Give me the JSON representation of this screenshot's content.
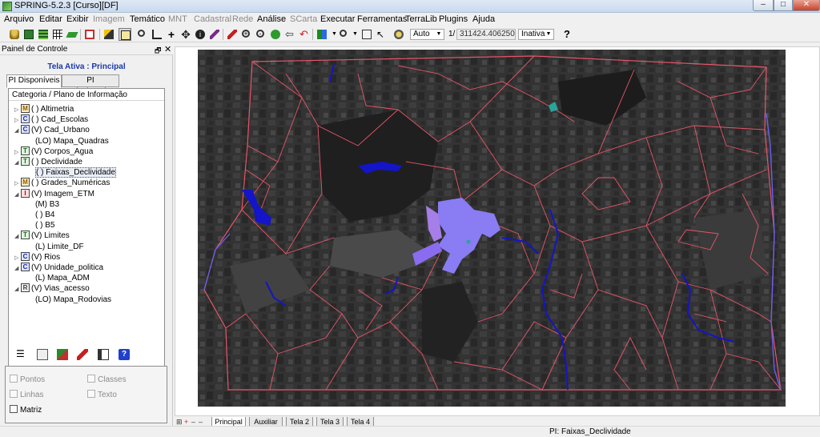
{
  "window": {
    "title": "SPRING-5.2.3 [Curso][DF]",
    "min": "–",
    "max": "□",
    "close": "✕"
  },
  "menu": [
    {
      "label": "Arquivo",
      "enabled": true
    },
    {
      "label": "Editar",
      "enabled": true
    },
    {
      "label": "Exibir",
      "enabled": true
    },
    {
      "label": "Imagem",
      "enabled": false
    },
    {
      "label": "Temático",
      "enabled": true
    },
    {
      "label": "MNT",
      "enabled": false
    },
    {
      "label": "Cadastral",
      "enabled": false
    },
    {
      "label": "Rede",
      "enabled": false
    },
    {
      "label": "Análise",
      "enabled": true
    },
    {
      "label": "SCarta",
      "enabled": false
    },
    {
      "label": "Executar",
      "enabled": true
    },
    {
      "label": "Ferramentas",
      "enabled": true
    },
    {
      "label": "TerraLib",
      "enabled": true
    },
    {
      "label": "Plugins",
      "enabled": true
    },
    {
      "label": "Ajuda",
      "enabled": true
    }
  ],
  "toolbar": {
    "auto_combo": "Auto",
    "scale_prefix": "1/",
    "scale_value": "311424.406250",
    "state_combo": "Inativa",
    "help": "?"
  },
  "panel": {
    "title": "Painel de Controle",
    "active_screen": "Tela Ativa : Principal",
    "tab_available": "PI Disponíveis",
    "tab_selected": "PI Selecionados",
    "tree_header": "Categoria / Plano de Informação",
    "tree": [
      {
        "arrow": "▷",
        "badge": "M",
        "text": "( ) Altimetria",
        "level": 0
      },
      {
        "arrow": "▷",
        "badge": "C",
        "text": "( ) Cad_Escolas",
        "level": 0
      },
      {
        "arrow": "◢",
        "badge": "C",
        "text": "(V) Cad_Urbano",
        "level": 0
      },
      {
        "arrow": "",
        "badge": "",
        "text": "(LO) Mapa_Quadras",
        "level": 1
      },
      {
        "arrow": "▷",
        "badge": "T",
        "text": "(V) Corpos_Agua",
        "level": 0
      },
      {
        "arrow": "◢",
        "badge": "T",
        "text": "( ) Declividade",
        "level": 0
      },
      {
        "arrow": "",
        "badge": "",
        "text": "( ) Faixas_Declividade",
        "level": 1,
        "selected": true
      },
      {
        "arrow": "▷",
        "badge": "M",
        "text": "( ) Grades_Numéricas",
        "level": 0
      },
      {
        "arrow": "◢",
        "badge": "I",
        "text": "(V) Imagem_ETM",
        "level": 0
      },
      {
        "arrow": "",
        "badge": "",
        "text": "(M) B3",
        "level": 1
      },
      {
        "arrow": "",
        "badge": "",
        "text": "( ) B4",
        "level": 1
      },
      {
        "arrow": "",
        "badge": "",
        "text": "( ) B5",
        "level": 1
      },
      {
        "arrow": "◢",
        "badge": "T",
        "text": "(V) Limites",
        "level": 0
      },
      {
        "arrow": "",
        "badge": "",
        "text": "(L) Limite_DF",
        "level": 1
      },
      {
        "arrow": "▷",
        "badge": "C",
        "text": "(V) Rios",
        "level": 0
      },
      {
        "arrow": "◢",
        "badge": "C",
        "text": "(V) Unidade_politica",
        "level": 0
      },
      {
        "arrow": "",
        "badge": "",
        "text": "(L) Mapa_ADM",
        "level": 1
      },
      {
        "arrow": "◢",
        "badge": "R",
        "text": "(V) Vias_acesso",
        "level": 0
      },
      {
        "arrow": "",
        "badge": "",
        "text": "(LO) Mapa_Rodovias",
        "level": 1
      }
    ],
    "checks": {
      "pontos": "Pontos",
      "classes": "Classes",
      "linhas": "Linhas",
      "texto": "Texto",
      "matriz": "Matriz"
    }
  },
  "screens": {
    "nav": [
      "⊞",
      "+",
      "–",
      "–"
    ],
    "tabs": [
      "Principal",
      "Auxiliar",
      "Tela 2",
      "Tela 3",
      "Tela 4"
    ]
  },
  "status": {
    "pi": "PI: Faixas_Declividade"
  },
  "colors": {
    "roads": "#e8556a",
    "water": "#1414c8",
    "lake": "#8a7cf2",
    "boundary": "#6b5ef0",
    "teal": "#2aa39a"
  }
}
